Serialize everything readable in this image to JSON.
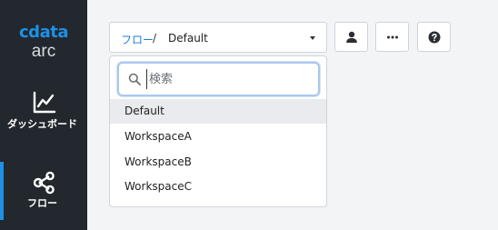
{
  "sidebar": {
    "logo_brand": "cdata",
    "logo_product": "arc",
    "items": [
      {
        "label": "ダッシュボード",
        "icon": "chart-line-icon",
        "active": false
      },
      {
        "label": "フロー",
        "icon": "flow-nodes-icon",
        "active": true
      }
    ]
  },
  "breadcrumb": {
    "link": "フロー",
    "separator": "/",
    "current": "Default"
  },
  "toolbar": {
    "user_icon": "user-icon",
    "more_icon": "ellipsis-icon",
    "help_icon": "help-icon"
  },
  "dropdown": {
    "search_placeholder": "検索",
    "search_value": "",
    "options": [
      "Default",
      "WorkspaceA",
      "WorkspaceB",
      "WorkspaceC"
    ],
    "selected": "Default"
  },
  "colors": {
    "accent": "#1e90e6",
    "sidebar_bg": "#22282d"
  }
}
